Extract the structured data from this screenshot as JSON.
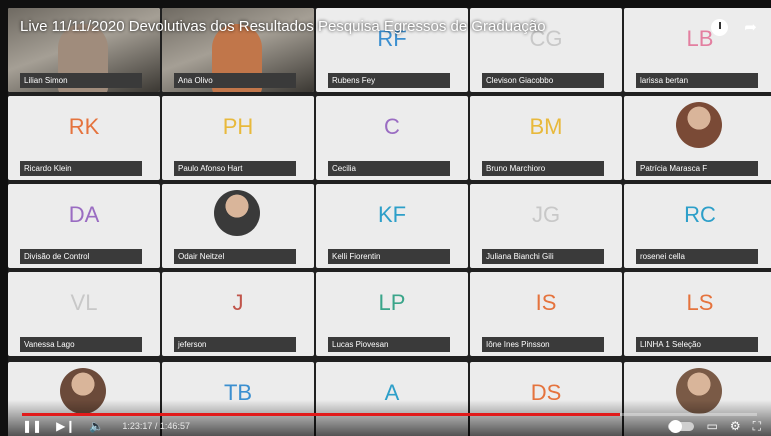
{
  "video": {
    "title": "Live 11/11/2020 Devolutivas dos Resultados Pesquisa Egressos de Graduação",
    "progress_fraction": 0.813,
    "current_time": "1:23:17",
    "duration": "1:46:57"
  },
  "participants": [
    {
      "name": "Lilian Simon",
      "initials": "",
      "type": "camera",
      "color": "#a08c7c"
    },
    {
      "name": "Ana Olivo",
      "initials": "",
      "type": "camera",
      "color": "#c1764a"
    },
    {
      "name": "Rubens Fey",
      "initials": "RF",
      "type": "initials",
      "color": "#3b8fd0"
    },
    {
      "name": "Clevison Giacobbo",
      "initials": "CG",
      "type": "initials",
      "color": "#c8c8c8"
    },
    {
      "name": "larissa bertan",
      "initials": "LB",
      "type": "initials",
      "color": "#e37fa0"
    },
    {
      "name": "Ricardo Klein",
      "initials": "RK",
      "type": "initials",
      "color": "#e5733d"
    },
    {
      "name": "Paulo Afonso Hart",
      "initials": "PH",
      "type": "initials",
      "color": "#e8b93c"
    },
    {
      "name": "Cecilia",
      "initials": "C",
      "type": "initials",
      "color": "#9a6cc2"
    },
    {
      "name": "Bruno Marchioro",
      "initials": "BM",
      "type": "initials",
      "color": "#e8b93c"
    },
    {
      "name": "Patrícia Marasca F",
      "initials": "",
      "type": "photo",
      "color": "#7a4a36"
    },
    {
      "name": "Divisão de Control",
      "initials": "DA",
      "type": "initials",
      "color": "#9a6cc2"
    },
    {
      "name": "Odair Neitzel",
      "initials": "",
      "type": "photo",
      "color": "#3a3a3a"
    },
    {
      "name": "Kelli Fiorentin",
      "initials": "KF",
      "type": "initials",
      "color": "#2d9fc9"
    },
    {
      "name": "Juliana Bianchi Gili",
      "initials": "JG",
      "type": "initials",
      "color": "#c8c8c8"
    },
    {
      "name": "rosenei cella",
      "initials": "RC",
      "type": "initials",
      "color": "#2d9fc9"
    },
    {
      "name": "Vanessa Lago",
      "initials": "VL",
      "type": "initials",
      "color": "#c8c8c8"
    },
    {
      "name": "jeferson",
      "initials": "J",
      "type": "initials",
      "color": "#c0544a"
    },
    {
      "name": "Lucas Piovesan",
      "initials": "LP",
      "type": "initials",
      "color": "#3aa58a"
    },
    {
      "name": "Iône Ines Pinsson",
      "initials": "IS",
      "type": "initials",
      "color": "#e5733d"
    },
    {
      "name": "LINHA 1 Seleção",
      "initials": "LS",
      "type": "initials",
      "color": "#e5733d"
    },
    {
      "name": "",
      "initials": "",
      "type": "photo",
      "color": "#6b4a3a"
    },
    {
      "name": "",
      "initials": "TB",
      "type": "initials",
      "color": "#3b8fd0"
    },
    {
      "name": "",
      "initials": "A",
      "type": "initials",
      "color": "#2d9fc9"
    },
    {
      "name": "",
      "initials": "DS",
      "type": "initials",
      "color": "#e5733d"
    },
    {
      "name": "",
      "initials": "",
      "type": "photo",
      "color": "#7a5a46"
    }
  ],
  "icons": {
    "watch_later": "clock-icon",
    "share": "share-icon",
    "play_pause": "pause-icon",
    "next": "next-icon",
    "volume": "volume-icon",
    "autoplay": "autoplay-toggle",
    "subtitles": "subtitles-icon",
    "settings": "gear-icon",
    "fullscreen": "fullscreen-icon"
  }
}
